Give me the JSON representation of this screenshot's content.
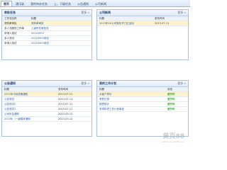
{
  "tabs": [
    "首页",
    "通讯录",
    "我的待办任务",
    "上、下级任务",
    "公告通知",
    "公司新闻"
  ],
  "panels": {
    "task": {
      "title": "审批任务",
      "more": "更多 »",
      "header": [
        "工作流名称",
        "标题"
      ],
      "rows": [
        [
          "采购单审批",
          "采购单审批"
        ],
        [
          "多人流程的工作单",
          "上级所在审批流"
        ],
        [
          "申请人测试",
          "20120903"
        ],
        [
          "多人测试",
          "20120903测试"
        ],
        [
          "申请人测试",
          "20120903测试"
        ]
      ]
    },
    "news": {
      "title": "公司新闻",
      "more": "更多 »",
      "header": [
        "标题",
        "发布时间"
      ],
      "rows": [
        [
          "2013年XX公司新年开门红活动",
          "2013-07-11"
        ]
      ]
    },
    "notice": {
      "title": "公告通知",
      "more": "更多 »",
      "header": [
        "标题",
        "发布时间"
      ],
      "rows": [
        [
          "2013年中秋放假通知",
          "2013-07-11"
        ],
        [
          "公告测试",
          "2013-07-11"
        ],
        [
          "公告测试2",
          "2013-07-11"
        ],
        [
          "公告测试1",
          "2013-07-11"
        ],
        [
          "公司年会通知",
          "2013-03-12"
        ],
        [
          "2013年（一级模样通知",
          "2013-03-12"
        ]
      ]
    },
    "work": {
      "title": "我的工作计划",
      "more": "更多 »",
      "header": [
        "标题",
        "状态"
      ],
      "rows": [
        [
          "大客户拜访",
          "进行中"
        ],
        [
          "考勤记录",
          "进行中"
        ],
        [
          "报表统计",
          "进行中"
        ],
        [
          "安排年终工作计划事宜",
          "进行中"
        ]
      ]
    }
  },
  "watermark": {
    "main": "黄页88",
    "sub": "www.huangye88.com"
  }
}
